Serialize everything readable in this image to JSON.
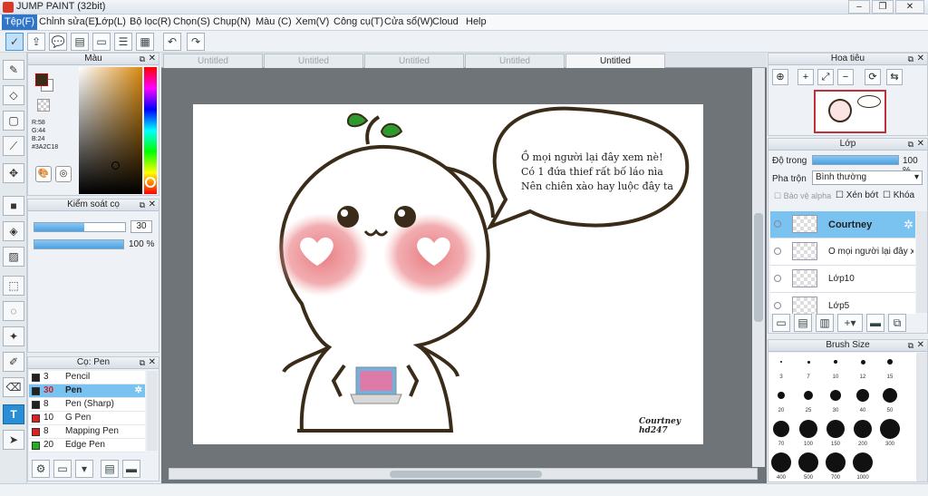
{
  "window": {
    "title": "JUMP PAINT (32bit)"
  },
  "menu": [
    {
      "label": "Tệp(F)",
      "active": true
    },
    {
      "label": "Chỉnh sửa(E)"
    },
    {
      "label": "Lớp(L)"
    },
    {
      "label": "Bộ lọc(R)"
    },
    {
      "label": "Chọn(S)"
    },
    {
      "label": "Chụp(N)"
    },
    {
      "label": "Màu (C)"
    },
    {
      "label": "Xem(V)"
    },
    {
      "label": "Công cụ(T)"
    },
    {
      "label": "Cửa sổ(W)"
    },
    {
      "label": "Cloud"
    },
    {
      "label": "Help"
    }
  ],
  "tabs": [
    {
      "label": "Untitled"
    },
    {
      "label": "Untitled"
    },
    {
      "label": "Untitled"
    },
    {
      "label": "Untitled"
    },
    {
      "label": "Untitled",
      "active": true
    }
  ],
  "color_panel": {
    "title": "Màu",
    "r": "R:58",
    "g": "G:44",
    "b": "B:24",
    "hex": "#3A2C18",
    "primary_color": "#3A2C18"
  },
  "brush_control": {
    "title": "Kiểm soát cọ",
    "size_value": "30",
    "size_fill": 0.55,
    "opacity_value": "100 %",
    "opacity_fill": 1.0
  },
  "brush_list": {
    "title": "Cọ: Pen",
    "items": [
      {
        "size": "3",
        "name": "Pencil",
        "color": "#222222"
      },
      {
        "size": "30",
        "name": "Pen",
        "color": "#222222",
        "selected": true
      },
      {
        "size": "8",
        "name": "Pen (Sharp)",
        "color": "#222222"
      },
      {
        "size": "10",
        "name": "G Pen",
        "color": "#e02020"
      },
      {
        "size": "8",
        "name": "Mapping Pen",
        "color": "#e02020"
      },
      {
        "size": "20",
        "name": "Edge Pen",
        "color": "#20b020"
      }
    ]
  },
  "navigator": {
    "title": "Hoa tiêu"
  },
  "layers": {
    "title": "Lớp",
    "opacity_label": "Độ trong",
    "opacity_value": "100 %",
    "blend_label": "Pha trộn",
    "blend_value": "Bình thường",
    "protect_alpha": "Bảo vệ alpha",
    "clipping": "Xén bớt",
    "lock": "Khóa",
    "items": [
      {
        "name": "Courtney",
        "selected": true
      },
      {
        "name": "Ô mọi người lại đây xem"
      },
      {
        "name": "Lớp10"
      },
      {
        "name": "Lớp5"
      }
    ]
  },
  "brush_size": {
    "title": "Brush Size",
    "sizes": [
      "3",
      "7",
      "10",
      "12",
      "15",
      "20",
      "25",
      "30",
      "40",
      "50",
      "70",
      "100",
      "150",
      "200",
      "300",
      "400",
      "500",
      "700",
      "1000"
    ]
  },
  "artwork": {
    "speech_lines": [
      "Ồ mọi người lại đây xem nè!",
      "Có 1 đứa thief rất bố láo nìa",
      "Nên chiên xào hay luộc đây ta"
    ],
    "signature_1": "Courtney",
    "signature_2": "hd247"
  }
}
